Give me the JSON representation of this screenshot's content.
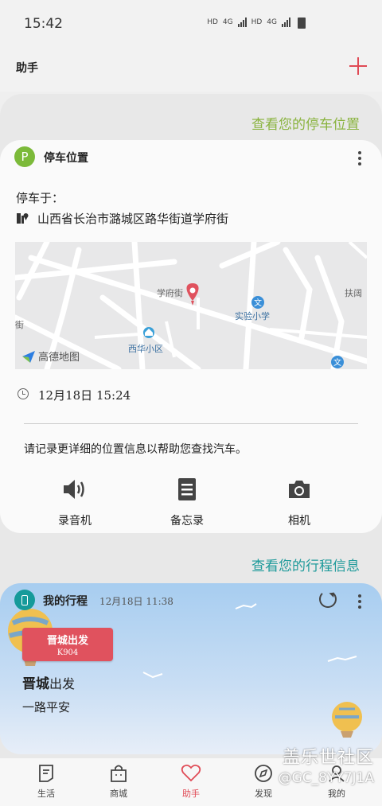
{
  "status_bar": {
    "time": "15:42",
    "net1": "HD",
    "net1_gen": "4G",
    "net2": "HD",
    "net2_gen": "4G"
  },
  "app_bar": {
    "title": "助手",
    "add_icon": "plus-icon"
  },
  "parking": {
    "section_link": "查看您的停车位置",
    "badge": "P",
    "title": "停车位置",
    "parked_at_label": "停车于：",
    "address": "山西省长治市潞城区路华街道学府街",
    "map": {
      "street_label_1": "学府街",
      "street_label_2": "街",
      "poi_school": "实验小学",
      "poi_community": "西华小区",
      "poi_edge": "扶阔",
      "logo_text": "高德地图"
    },
    "datetime": "12月18日  15:24",
    "hint": "请记录更详细的位置信息以帮助您查找汽车。",
    "actions": [
      {
        "label": "录音机",
        "icon": "speaker-icon"
      },
      {
        "label": "备忘录",
        "icon": "memo-icon"
      },
      {
        "label": "相机",
        "icon": "camera-icon"
      }
    ]
  },
  "trip": {
    "section_link": "查看您的行程信息",
    "title": "我的行程",
    "time": "12月18日  11:38",
    "tag_title": "晋城出发",
    "tag_train": "K904",
    "dest_main": "晋城",
    "dest_suffix": "出发",
    "wish": "一路平安"
  },
  "bottom_nav": [
    {
      "label": "生活",
      "icon": "life-icon"
    },
    {
      "label": "商城",
      "icon": "shopping-bag-icon"
    },
    {
      "label": "助手",
      "icon": "heart-icon",
      "active": true
    },
    {
      "label": "发现",
      "icon": "compass-icon"
    },
    {
      "label": "我的",
      "icon": "user-icon"
    }
  ],
  "watermark": {
    "line1": "盖乐世社区",
    "line2": "@GC_8YY7J1A"
  },
  "colors": {
    "accent_red": "#e04a55",
    "parking_green": "#7cba3a",
    "link_green": "#8ab33f",
    "link_teal": "#1e9a9a",
    "trip_teal": "#159a9a"
  }
}
